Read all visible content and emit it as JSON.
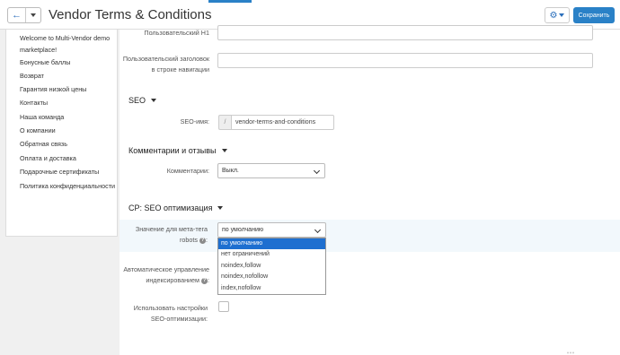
{
  "header": {
    "title": "Vendor Terms & Conditions",
    "back_icon": "arrow-left-icon",
    "gear_icon": "gear-icon",
    "save_label": "Сохранить",
    "accent_color": "#2a81c7"
  },
  "sidebar": {
    "items": [
      {
        "label": "Welcome to Multi-Vendor demo marketplace!"
      },
      {
        "label": "Бонусные баллы"
      },
      {
        "label": "Возврат"
      },
      {
        "label": "Гарантия низкой цены"
      },
      {
        "label": "Контакты"
      },
      {
        "label": "Наша команда"
      },
      {
        "label": "О компании"
      },
      {
        "label": "Обратная связь"
      },
      {
        "label": "Оплата и доставка"
      },
      {
        "label": "Подарочные сертификаты"
      },
      {
        "label": "Политика конфиденциальности"
      }
    ]
  },
  "form": {
    "custom_h1_label": "Пользовательский H1",
    "custom_h1_value": "",
    "nav_title_label": "Пользовательский заголовок в строке навигации",
    "nav_title_value": "",
    "seo_section": "SEO",
    "seo_name_label": "SEO-имя:",
    "seo_prefix": "/",
    "seo_name_value": "vendor-terms-and-conditions",
    "comments_section": "Комментарии и отзывы",
    "comments_label": "Комментарии:",
    "comments_value": "Выкл.",
    "cp_seo_section": "CP: SEO оптимизация",
    "robots_label": "Значение для мета-тега robots",
    "robots_value": "по умолчанию",
    "robots_options": [
      "по умолчанию",
      "нет ограничений",
      "noindex,follow",
      "noindex,nofollow",
      "index,nofollow"
    ],
    "robots_selected": "по умолчанию",
    "auto_index_label": "Автоматическое управление индексированием",
    "use_seo_label": "Использовать настройки SEO-оптимизации:",
    "use_seo_checked": false,
    "help_icon_glyph": "?"
  }
}
